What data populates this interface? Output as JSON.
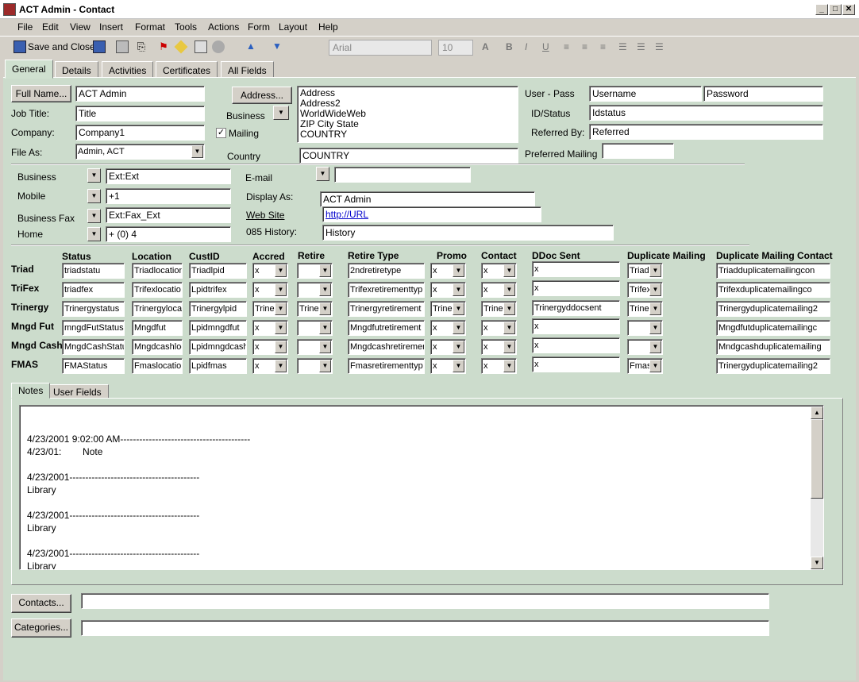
{
  "window": {
    "title": "ACT Admin - Contact",
    "min": "_",
    "max": "□",
    "close": "✕"
  },
  "menu": [
    "File",
    "Edit",
    "View",
    "Insert",
    "Format",
    "Tools",
    "Actions",
    "Form",
    "Layout",
    "Help"
  ],
  "toolbar": {
    "save_close": "Save and Close",
    "font": "Arial",
    "size": "10"
  },
  "tabs": [
    "General",
    "Details",
    "Activities",
    "Certificates",
    "All Fields"
  ],
  "general": {
    "full_name_btn": "Full Name...",
    "full_name": "ACT Admin",
    "job_title_label": "Job Title:",
    "job_title": "Title",
    "company_label": "Company:",
    "company": "Company1",
    "file_as_label": "File As:",
    "file_as": "Admin, ACT",
    "address_btn": "Address...",
    "address_type": "Business",
    "mailing_label": "Mailing",
    "mailing_check": "✓",
    "address_lines": [
      "Address",
      "Address2",
      "WorldWideWeb",
      "ZIP  City  State",
      "COUNTRY"
    ],
    "country_label": "Country",
    "country": "COUNTRY",
    "user_pass_label": "User - Pass",
    "username": "Username",
    "password": "Password",
    "id_status_label": "ID/Status",
    "id_status": "Idstatus",
    "referred_label": "Referred By:",
    "referred": "Referred",
    "pref_mail_label": "Preferred Mailing",
    "pref_mail": ""
  },
  "phones": [
    {
      "label": "Business",
      "value": "Ext:Ext"
    },
    {
      "label": "Mobile",
      "value": "+1"
    },
    {
      "label": "Business Fax",
      "value": "Ext:Fax_Ext"
    },
    {
      "label": "Home",
      "value": "+ (0) 4"
    }
  ],
  "contact_info": {
    "email_label": "E-mail",
    "email": "",
    "display_as_label": "Display As:",
    "display_as": "ACT Admin",
    "website_label": "Web Site",
    "website": "http://URL",
    "history_label": "085 History:",
    "history": "History"
  },
  "grid": {
    "headers": [
      "Status",
      "Location",
      "CustID",
      "Accred",
      "Retire",
      "Retire Type",
      "Promo",
      "Contact",
      "DDoc Sent",
      "Duplicate Mailing",
      "Duplicate Mailing Contact"
    ],
    "rows": [
      {
        "name": "Triad",
        "status": "triadstatu",
        "location": "Triadlocation",
        "custid": "Triadlpid",
        "accred": "x",
        "retire": "",
        "retire_type": "2ndretiretype",
        "promo": "x",
        "contact": "x",
        "ddoc": "x",
        "dup": "Triadd",
        "dup_contact": "Triadduplicatemailingcon"
      },
      {
        "name": "TriFex",
        "status": "triadfex",
        "location": "Trifexlocatio",
        "custid": "Lpidtrifex",
        "accred": "x",
        "retire": "",
        "retire_type": "Trifexretirementtyp",
        "promo": "x",
        "contact": "x",
        "ddoc": "x",
        "dup": "Trifex",
        "dup_contact": "Trifexduplicatemailingco"
      },
      {
        "name": "Trinergy",
        "status": "Trinergystatus",
        "location": "Trinergyloca",
        "custid": "Trinergylpid",
        "accred": "Triner",
        "retire": "Triner",
        "retire_type": "Trinergyretirement",
        "promo": "Triner",
        "contact": "Triner",
        "ddoc": "Trinergyddocsent",
        "dup": "Triner",
        "dup_contact": "Trinergyduplicatemailing2"
      },
      {
        "name": "Mngd Fut",
        "status": "mngdFutStatus",
        "location": "Mngdfut",
        "custid": "Lpidmngdfut",
        "accred": "x",
        "retire": "",
        "retire_type": "Mngdfutretirement",
        "promo": "x",
        "contact": "x",
        "ddoc": "x",
        "dup": "",
        "dup_contact": "Mngdfutduplicatemailingc"
      },
      {
        "name": "Mngd Cash",
        "status": "MngdCashStatu",
        "location": "Mngdcashloc",
        "custid": "Lpidmngdcash",
        "accred": "x",
        "retire": "",
        "retire_type": "Mngdcashretiremer",
        "promo": "x",
        "contact": "x",
        "ddoc": "x",
        "dup": "",
        "dup_contact": "Mndgcashduplicatemailing"
      },
      {
        "name": "FMAS",
        "status": "FMAStatus",
        "location": "Fmaslocation",
        "custid": "Lpidfmas",
        "accred": "x",
        "retire": "",
        "retire_type": "Fmasretirementtyp",
        "promo": "x",
        "contact": "x",
        "ddoc": "x",
        "dup": "Fmas",
        "dup_contact": "Trinergyduplicatemailing2"
      }
    ]
  },
  "notes_tabs": [
    "Notes",
    "User Fields"
  ],
  "notes": [
    "4/23/2001 9:02:00 AM-----------------------------------------",
    "4/23/01:        Note",
    "",
    "4/23/2001-----------------------------------------",
    "Library",
    "",
    "4/23/2001-----------------------------------------",
    "Library",
    "",
    "4/23/2001-----------------------------------------",
    "Library"
  ],
  "bottom": {
    "contacts_btn": "Contacts...",
    "contacts": "",
    "categories_btn": "Categories...",
    "categories": ""
  }
}
